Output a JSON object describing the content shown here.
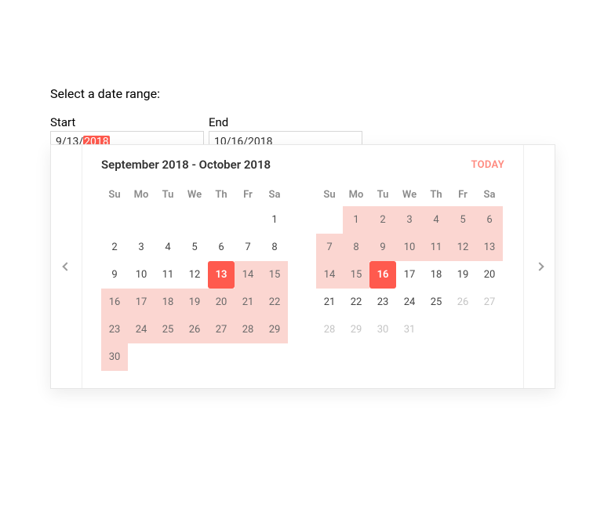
{
  "prompt": "Select a date range:",
  "start_label": "Start",
  "end_label": "End",
  "start_value_prefix": "9/13/",
  "start_value_sel": "2018",
  "end_value": "10/16/2018",
  "range_title": "September 2018 - October 2018",
  "today_label": "TODAY",
  "dow": [
    "Su",
    "Mo",
    "Tu",
    "We",
    "Th",
    "Fr",
    "Sa"
  ],
  "months": [
    {
      "name": "September 2018",
      "weeks": [
        [
          {
            "t": ""
          },
          {
            "t": ""
          },
          {
            "t": ""
          },
          {
            "t": ""
          },
          {
            "t": ""
          },
          {
            "t": ""
          },
          {
            "t": "1"
          }
        ],
        [
          {
            "t": "2"
          },
          {
            "t": "3"
          },
          {
            "t": "4"
          },
          {
            "t": "5"
          },
          {
            "t": "6"
          },
          {
            "t": "7"
          },
          {
            "t": "8"
          }
        ],
        [
          {
            "t": "9"
          },
          {
            "t": "10"
          },
          {
            "t": "11"
          },
          {
            "t": "12"
          },
          {
            "t": "13",
            "s": "selected"
          },
          {
            "t": "14",
            "s": "inrange"
          },
          {
            "t": "15",
            "s": "inrange"
          }
        ],
        [
          {
            "t": "16",
            "s": "inrange"
          },
          {
            "t": "17",
            "s": "inrange"
          },
          {
            "t": "18",
            "s": "inrange"
          },
          {
            "t": "19",
            "s": "inrange"
          },
          {
            "t": "20",
            "s": "inrange"
          },
          {
            "t": "21",
            "s": "inrange"
          },
          {
            "t": "22",
            "s": "inrange"
          }
        ],
        [
          {
            "t": "23",
            "s": "inrange"
          },
          {
            "t": "24",
            "s": "inrange"
          },
          {
            "t": "25",
            "s": "inrange"
          },
          {
            "t": "26",
            "s": "inrange"
          },
          {
            "t": "27",
            "s": "inrange"
          },
          {
            "t": "28",
            "s": "inrange"
          },
          {
            "t": "29",
            "s": "inrange"
          }
        ],
        [
          {
            "t": "30",
            "s": "inrange"
          },
          {
            "t": ""
          },
          {
            "t": ""
          },
          {
            "t": ""
          },
          {
            "t": ""
          },
          {
            "t": ""
          },
          {
            "t": ""
          }
        ]
      ]
    },
    {
      "name": "October 2018",
      "weeks": [
        [
          {
            "t": ""
          },
          {
            "t": "1",
            "s": "inrange"
          },
          {
            "t": "2",
            "s": "inrange"
          },
          {
            "t": "3",
            "s": "inrange"
          },
          {
            "t": "4",
            "s": "inrange"
          },
          {
            "t": "5",
            "s": "inrange"
          },
          {
            "t": "6",
            "s": "inrange"
          }
        ],
        [
          {
            "t": "7",
            "s": "inrange"
          },
          {
            "t": "8",
            "s": "inrange"
          },
          {
            "t": "9",
            "s": "inrange"
          },
          {
            "t": "10",
            "s": "inrange"
          },
          {
            "t": "11",
            "s": "inrange"
          },
          {
            "t": "12",
            "s": "inrange"
          },
          {
            "t": "13",
            "s": "inrange"
          }
        ],
        [
          {
            "t": "14",
            "s": "inrange"
          },
          {
            "t": "15",
            "s": "inrange"
          },
          {
            "t": "16",
            "s": "selected"
          },
          {
            "t": "17"
          },
          {
            "t": "18"
          },
          {
            "t": "19"
          },
          {
            "t": "20"
          }
        ],
        [
          {
            "t": "21"
          },
          {
            "t": "22"
          },
          {
            "t": "23"
          },
          {
            "t": "24"
          },
          {
            "t": "25"
          },
          {
            "t": "26",
            "s": "muted"
          },
          {
            "t": "27",
            "s": "muted"
          }
        ],
        [
          {
            "t": "28",
            "s": "muted"
          },
          {
            "t": "29",
            "s": "muted"
          },
          {
            "t": "30",
            "s": "muted"
          },
          {
            "t": "31",
            "s": "muted"
          },
          {
            "t": ""
          },
          {
            "t": ""
          },
          {
            "t": ""
          }
        ]
      ]
    }
  ]
}
